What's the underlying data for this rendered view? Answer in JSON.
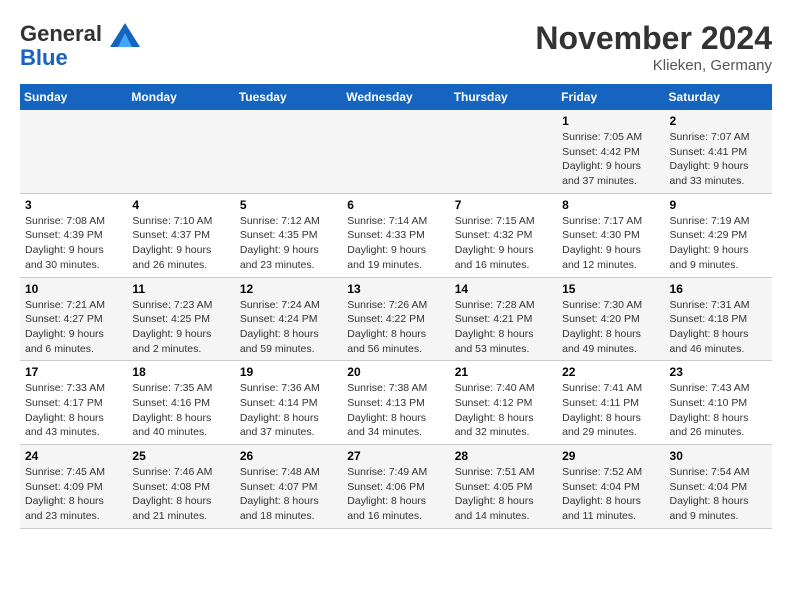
{
  "header": {
    "logo_line1": "General",
    "logo_line2": "Blue",
    "month_title": "November 2024",
    "location": "Klieken, Germany"
  },
  "weekdays": [
    "Sunday",
    "Monday",
    "Tuesday",
    "Wednesday",
    "Thursday",
    "Friday",
    "Saturday"
  ],
  "weeks": [
    [
      {
        "day": "",
        "info": ""
      },
      {
        "day": "",
        "info": ""
      },
      {
        "day": "",
        "info": ""
      },
      {
        "day": "",
        "info": ""
      },
      {
        "day": "",
        "info": ""
      },
      {
        "day": "1",
        "info": "Sunrise: 7:05 AM\nSunset: 4:42 PM\nDaylight: 9 hours\nand 37 minutes."
      },
      {
        "day": "2",
        "info": "Sunrise: 7:07 AM\nSunset: 4:41 PM\nDaylight: 9 hours\nand 33 minutes."
      }
    ],
    [
      {
        "day": "3",
        "info": "Sunrise: 7:08 AM\nSunset: 4:39 PM\nDaylight: 9 hours\nand 30 minutes."
      },
      {
        "day": "4",
        "info": "Sunrise: 7:10 AM\nSunset: 4:37 PM\nDaylight: 9 hours\nand 26 minutes."
      },
      {
        "day": "5",
        "info": "Sunrise: 7:12 AM\nSunset: 4:35 PM\nDaylight: 9 hours\nand 23 minutes."
      },
      {
        "day": "6",
        "info": "Sunrise: 7:14 AM\nSunset: 4:33 PM\nDaylight: 9 hours\nand 19 minutes."
      },
      {
        "day": "7",
        "info": "Sunrise: 7:15 AM\nSunset: 4:32 PM\nDaylight: 9 hours\nand 16 minutes."
      },
      {
        "day": "8",
        "info": "Sunrise: 7:17 AM\nSunset: 4:30 PM\nDaylight: 9 hours\nand 12 minutes."
      },
      {
        "day": "9",
        "info": "Sunrise: 7:19 AM\nSunset: 4:29 PM\nDaylight: 9 hours\nand 9 minutes."
      }
    ],
    [
      {
        "day": "10",
        "info": "Sunrise: 7:21 AM\nSunset: 4:27 PM\nDaylight: 9 hours\nand 6 minutes."
      },
      {
        "day": "11",
        "info": "Sunrise: 7:23 AM\nSunset: 4:25 PM\nDaylight: 9 hours\nand 2 minutes."
      },
      {
        "day": "12",
        "info": "Sunrise: 7:24 AM\nSunset: 4:24 PM\nDaylight: 8 hours\nand 59 minutes."
      },
      {
        "day": "13",
        "info": "Sunrise: 7:26 AM\nSunset: 4:22 PM\nDaylight: 8 hours\nand 56 minutes."
      },
      {
        "day": "14",
        "info": "Sunrise: 7:28 AM\nSunset: 4:21 PM\nDaylight: 8 hours\nand 53 minutes."
      },
      {
        "day": "15",
        "info": "Sunrise: 7:30 AM\nSunset: 4:20 PM\nDaylight: 8 hours\nand 49 minutes."
      },
      {
        "day": "16",
        "info": "Sunrise: 7:31 AM\nSunset: 4:18 PM\nDaylight: 8 hours\nand 46 minutes."
      }
    ],
    [
      {
        "day": "17",
        "info": "Sunrise: 7:33 AM\nSunset: 4:17 PM\nDaylight: 8 hours\nand 43 minutes."
      },
      {
        "day": "18",
        "info": "Sunrise: 7:35 AM\nSunset: 4:16 PM\nDaylight: 8 hours\nand 40 minutes."
      },
      {
        "day": "19",
        "info": "Sunrise: 7:36 AM\nSunset: 4:14 PM\nDaylight: 8 hours\nand 37 minutes."
      },
      {
        "day": "20",
        "info": "Sunrise: 7:38 AM\nSunset: 4:13 PM\nDaylight: 8 hours\nand 34 minutes."
      },
      {
        "day": "21",
        "info": "Sunrise: 7:40 AM\nSunset: 4:12 PM\nDaylight: 8 hours\nand 32 minutes."
      },
      {
        "day": "22",
        "info": "Sunrise: 7:41 AM\nSunset: 4:11 PM\nDaylight: 8 hours\nand 29 minutes."
      },
      {
        "day": "23",
        "info": "Sunrise: 7:43 AM\nSunset: 4:10 PM\nDaylight: 8 hours\nand 26 minutes."
      }
    ],
    [
      {
        "day": "24",
        "info": "Sunrise: 7:45 AM\nSunset: 4:09 PM\nDaylight: 8 hours\nand 23 minutes."
      },
      {
        "day": "25",
        "info": "Sunrise: 7:46 AM\nSunset: 4:08 PM\nDaylight: 8 hours\nand 21 minutes."
      },
      {
        "day": "26",
        "info": "Sunrise: 7:48 AM\nSunset: 4:07 PM\nDaylight: 8 hours\nand 18 minutes."
      },
      {
        "day": "27",
        "info": "Sunrise: 7:49 AM\nSunset: 4:06 PM\nDaylight: 8 hours\nand 16 minutes."
      },
      {
        "day": "28",
        "info": "Sunrise: 7:51 AM\nSunset: 4:05 PM\nDaylight: 8 hours\nand 14 minutes."
      },
      {
        "day": "29",
        "info": "Sunrise: 7:52 AM\nSunset: 4:04 PM\nDaylight: 8 hours\nand 11 minutes."
      },
      {
        "day": "30",
        "info": "Sunrise: 7:54 AM\nSunset: 4:04 PM\nDaylight: 8 hours\nand 9 minutes."
      }
    ]
  ]
}
